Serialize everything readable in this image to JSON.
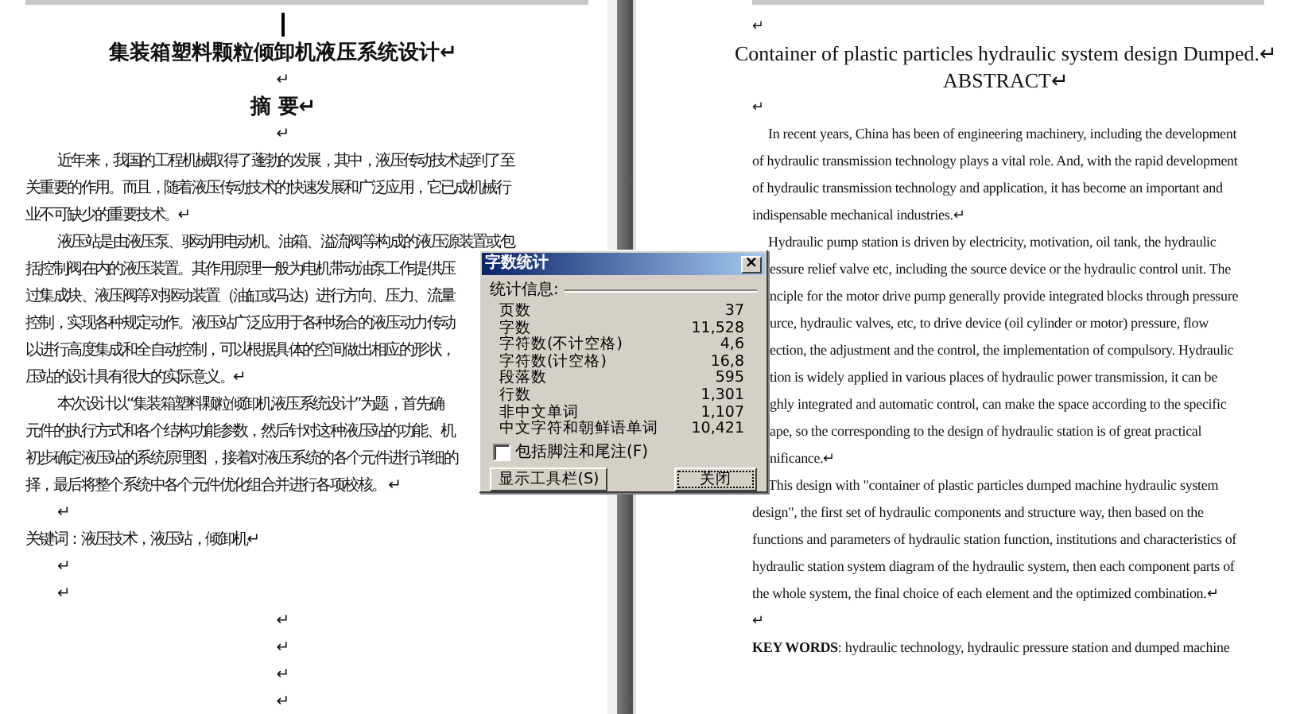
{
  "left_page": {
    "lines": [
      {
        "kind": "cursor"
      },
      {
        "kind": "title",
        "text": "集装箱塑料颗粒倾卸机液压系统设计↵"
      },
      {
        "kind": "center",
        "text": "↵"
      },
      {
        "kind": "heading",
        "text": "摘 要↵"
      },
      {
        "kind": "center",
        "text": "↵"
      },
      {
        "kind": "first",
        "text": "近年来，我国的工程机械取得了蓬勃的发展，其中，液压传动技术起到了至"
      },
      {
        "kind": "line",
        "text": "关重要的作用。而且，随着液压传动技术的快速发展和广泛应用，它已成机械行"
      },
      {
        "kind": "line",
        "text": "业不可缺少的重要技术。↵"
      },
      {
        "kind": "first",
        "text": "液压站是由液压泵、驱动用电动机、油箱、溢流阀等构成的液压源装置或包"
      },
      {
        "kind": "line",
        "text": "括控制阀在内的液压装置。其作用原理一般为电机带动油泵工作提供压"
      },
      {
        "kind": "line",
        "text": "过集成块、液压阀等对驱动装置（油缸或马达）进行方向、压力、流量"
      },
      {
        "kind": "line",
        "text": "控制，实现各种规定动作。液压站广泛应用于各种场合的液压动力传动"
      },
      {
        "kind": "line",
        "text": "以进行高度集成和全自动控制，可以根据具体的空间做出相应的形状，"
      },
      {
        "kind": "line",
        "text": "压站的设计具有很大的实际意义。↵"
      },
      {
        "kind": "first",
        "text": "本次设计以“集装箱塑料颗粒倾卸机液压系统设计”为题，首先确"
      },
      {
        "kind": "line",
        "text": "元件的执行方式和各个结构功能参数，然后针对这种液压站的功能、机"
      },
      {
        "kind": "line",
        "text": "初步确定液压站的系统原理图 ，接着对液压系统的各个元件进行详细的"
      },
      {
        "kind": "line",
        "text": "择，最后将整个系统中各个元件优化组合并进行各项校核。 ↵"
      },
      {
        "kind": "first",
        "text": "↵"
      },
      {
        "kind": "line",
        "text": "关键词：液压技术，液压站，倾卸机↵"
      },
      {
        "kind": "first",
        "text": "↵"
      },
      {
        "kind": "first",
        "text": "↵"
      },
      {
        "kind": "center",
        "text": "↵"
      },
      {
        "kind": "center",
        "text": "↵"
      },
      {
        "kind": "center",
        "text": "↵"
      },
      {
        "kind": "center",
        "text": "↵"
      }
    ]
  },
  "right_page": {
    "lines": [
      {
        "kind": "line",
        "text": "↵"
      },
      {
        "kind": "title",
        "text": "Container of plastic particles hydraulic system design Dumped.↵"
      },
      {
        "kind": "title",
        "text": "ABSTRACT↵"
      },
      {
        "kind": "line",
        "text": "↵"
      },
      {
        "kind": "first",
        "text": "In recent years, China has been of engineering machinery, including the development"
      },
      {
        "kind": "line",
        "text": "of hydraulic transmission technology plays a vital role. And, with the rapid development"
      },
      {
        "kind": "line",
        "text": "of hydraulic transmission technology and application, it has become an important and"
      },
      {
        "kind": "line",
        "text": "indispensable mechanical industries.↵"
      },
      {
        "kind": "first",
        "text": "Hydraulic pump station is driven by electricity, motivation, oil tank, the hydraulic"
      },
      {
        "kind": "cut",
        "text": "essure relief valve etc, including the source device or the hydraulic control unit. The"
      },
      {
        "kind": "cut",
        "text": "nciple for the motor drive pump generally provide integrated blocks through pressure"
      },
      {
        "kind": "cut",
        "text": "urce, hydraulic valves, etc, to drive device (oil cylinder or motor) pressure, flow"
      },
      {
        "kind": "cut",
        "text": "ection, the adjustment and the control, the implementation of compulsory. Hydraulic"
      },
      {
        "kind": "cut",
        "text": "tion is widely applied in various places of hydraulic power transmission, it can be"
      },
      {
        "kind": "cut",
        "text": "ghly integrated and automatic control, can make the space according to the specific"
      },
      {
        "kind": "cut",
        "text": "ape, so the corresponding to the design of hydraulic station is of great practical"
      },
      {
        "kind": "cut",
        "text": "nificance.↵"
      },
      {
        "kind": "first",
        "text": "This design with \"container of plastic particles dumped machine hydraulic system"
      },
      {
        "kind": "line",
        "text": "design\", the first set of hydraulic components and structure way, then based on the"
      },
      {
        "kind": "line",
        "text": "functions and parameters of hydraulic station function, institutions and characteristics of"
      },
      {
        "kind": "line",
        "text": "hydraulic station system diagram of the hydraulic system, then each component parts of"
      },
      {
        "kind": "line",
        "text": "the whole system, the final choice of each element and the optimized combination.↵"
      },
      {
        "kind": "line",
        "text": "↵"
      },
      {
        "kind": "line",
        "text": "**KEY WORDS**: hydraulic technology, hydraulic pressure station and dumped machine"
      }
    ]
  },
  "dialog": {
    "title": "字数统计",
    "close": "×",
    "group": "统计信息:",
    "stats": [
      {
        "label": "页数",
        "value": "37"
      },
      {
        "label": "字数",
        "value": "11,528"
      },
      {
        "label": "字符数(不计空格)",
        "value": "4,6"
      },
      {
        "label": "字符数(计空格)",
        "value": "16,8"
      },
      {
        "label": "段落数",
        "value": "595"
      },
      {
        "label": "行数",
        "value": "1,301"
      },
      {
        "label": "非中文单词",
        "value": "1,107"
      },
      {
        "label": "中文字符和朝鲜语单词",
        "value": "10,421"
      }
    ],
    "checkbox": {
      "label": "包括脚注和尾注(F)",
      "checked": false
    },
    "buttons": [
      {
        "label": "显示工具栏(S)",
        "focused": false
      },
      {
        "label": "关闭",
        "focused": true
      }
    ]
  }
}
